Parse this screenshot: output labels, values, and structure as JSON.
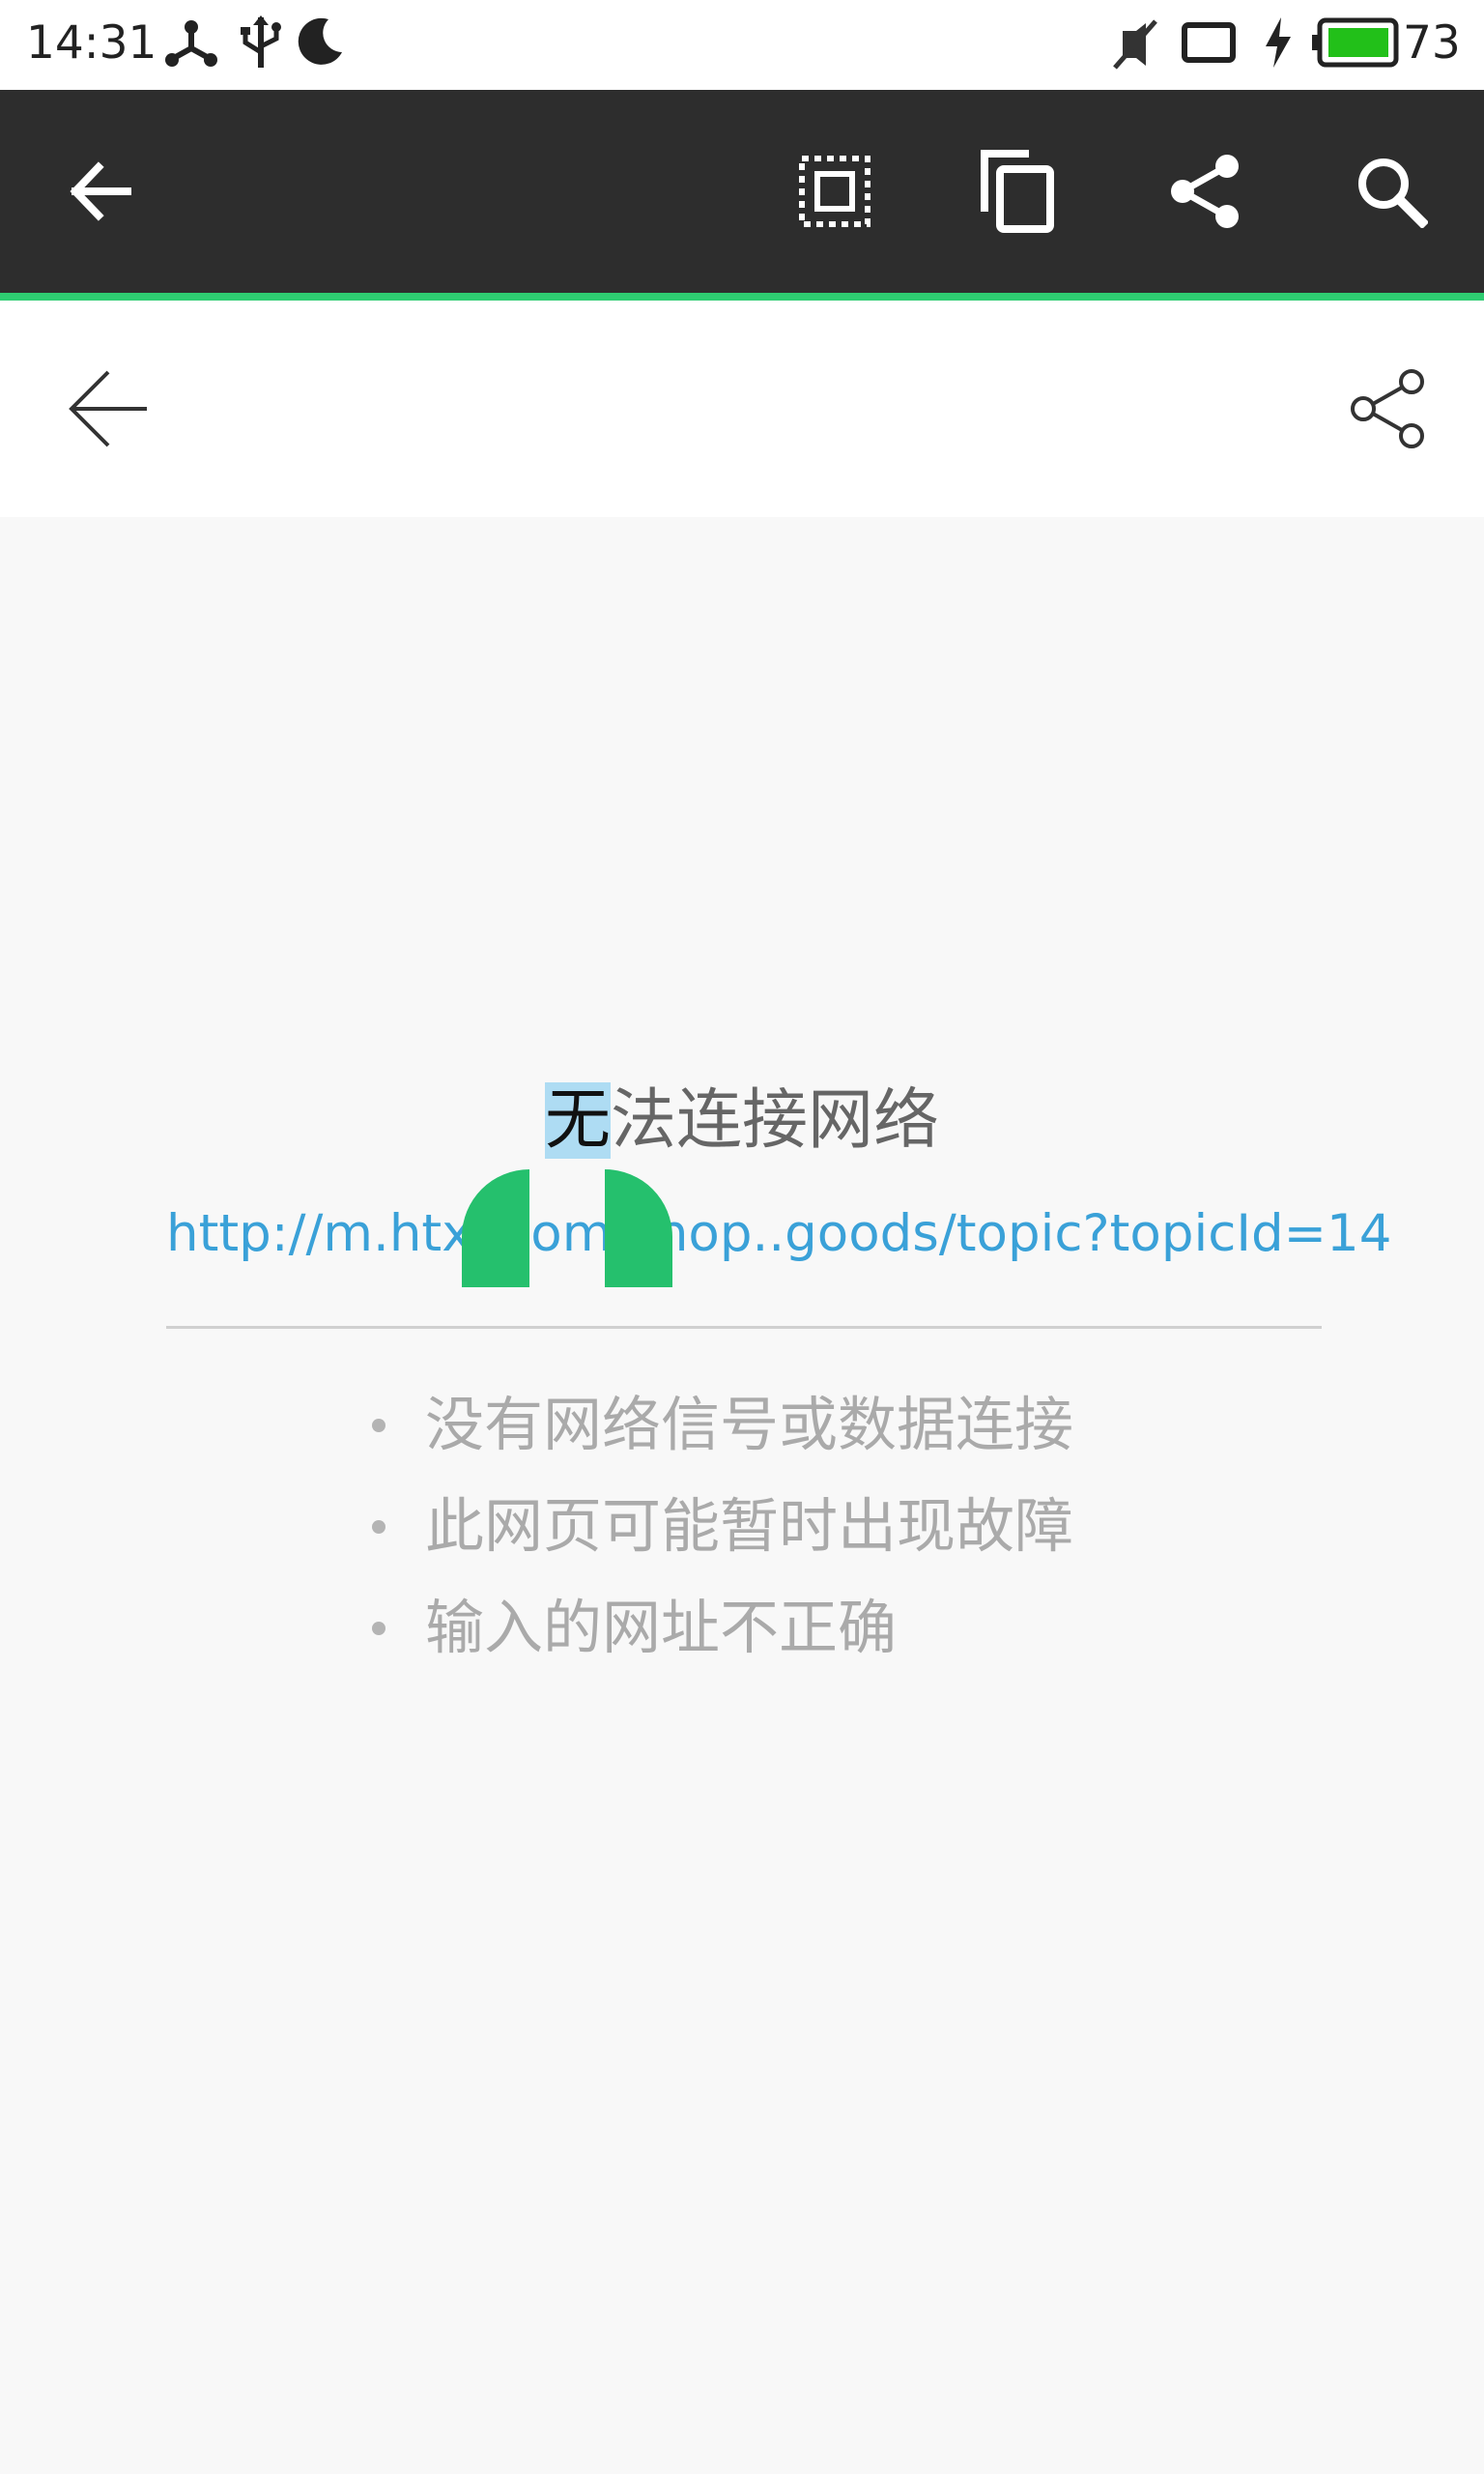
{
  "status_bar": {
    "time": "14:31",
    "battery_level": "73",
    "left_icons": [
      "share-hub-icon",
      "usb-icon",
      "moon-icon"
    ],
    "right_icons": [
      "vibrate-off-icon",
      "screen-icon",
      "charging-icon",
      "battery-icon"
    ],
    "battery_color": "#22c019"
  },
  "selection_toolbar": {
    "background": "#2d2d2d",
    "accent": "#2ecc71",
    "buttons": [
      "back-arrow-icon",
      "select-all-icon",
      "copy-icon",
      "share-icon",
      "search-icon"
    ]
  },
  "page_header": {
    "buttons": [
      "back-arrow-icon",
      "share-icon"
    ]
  },
  "error": {
    "title_selected": "无",
    "title_rest": "法连接网络",
    "url": "http://m.htxl.com/shop..goods/topic?topicId=14",
    "url_color": "#3aa1d8",
    "reasons": [
      "没有网络信号或数据连接",
      "此网页可能暂时出现故障",
      "输入的网址不正确"
    ]
  }
}
